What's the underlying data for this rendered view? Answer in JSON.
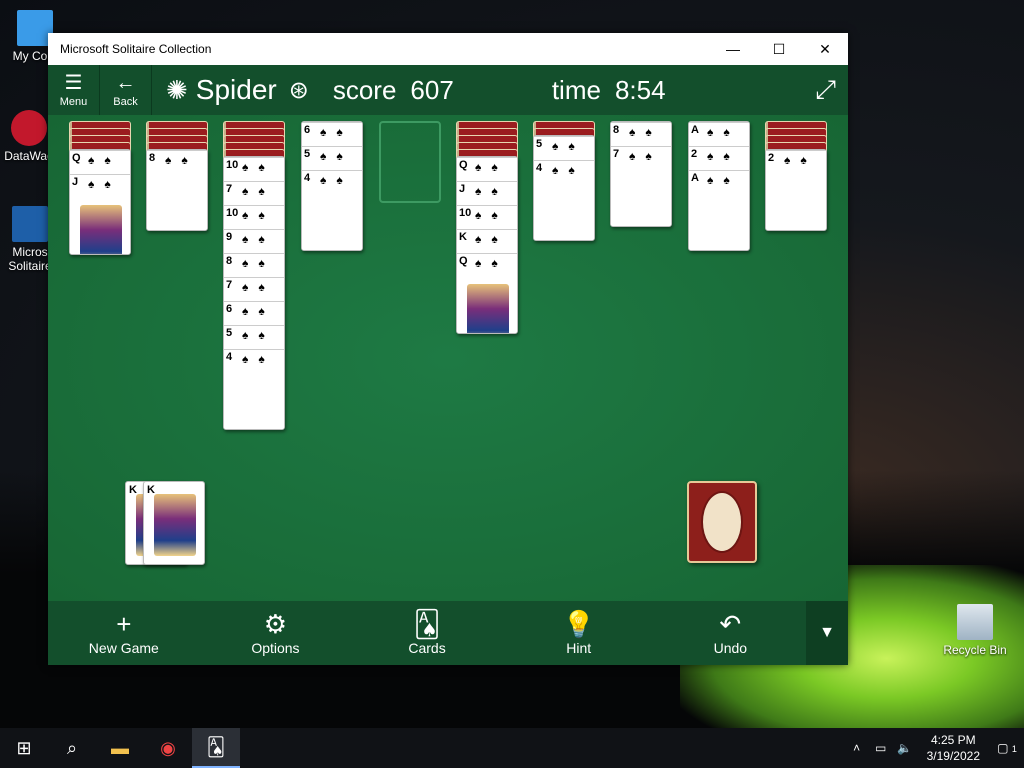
{
  "desktop": {
    "icons": [
      {
        "label": "My Com"
      },
      {
        "label": "DataWag"
      },
      {
        "label": "Micros Solitaire"
      },
      {
        "label": "Recycle Bin"
      }
    ]
  },
  "window": {
    "title": "Microsoft Solitaire Collection",
    "controls": {
      "minimize": "—",
      "maximize": "☐",
      "close": "✕"
    }
  },
  "appbar": {
    "menu_label": "Menu",
    "back_label": "Back",
    "game_title": "Spider",
    "score_label": "score",
    "score_value": "607",
    "time_label": "time",
    "time_value": "8:54"
  },
  "tableau": {
    "columns": [
      {
        "hidden": 4,
        "face": [
          "Q",
          "J"
        ]
      },
      {
        "hidden": 4,
        "face": [
          "8"
        ]
      },
      {
        "hidden": 5,
        "face": [
          "10",
          "7",
          "10",
          "9",
          "8",
          "7",
          "6",
          "5",
          "4"
        ]
      },
      {
        "hidden": 0,
        "face": [
          "6",
          "5",
          "4"
        ]
      },
      {
        "hidden": 0,
        "face": [],
        "empty": true
      },
      {
        "hidden": 5,
        "face": [
          "Q",
          "J",
          "10",
          "K",
          "Q"
        ]
      },
      {
        "hidden": 2,
        "face": [
          "5",
          "4"
        ]
      },
      {
        "hidden": 0,
        "face": [
          "8",
          "7"
        ]
      },
      {
        "hidden": 0,
        "face": [
          "A",
          "2",
          "A"
        ]
      },
      {
        "hidden": 4,
        "face": [
          "2"
        ]
      }
    ],
    "suit_glyph": "♠",
    "completed_piles": [
      "K",
      "K"
    ]
  },
  "bottombar": {
    "new_game_label": "New Game",
    "options_label": "Options",
    "cards_label": "Cards",
    "hint_label": "Hint",
    "undo_label": "Undo"
  },
  "taskbar": {
    "time": "4:25 PM",
    "date": "3/19/2022",
    "notification_count": "1"
  },
  "colors": {
    "felt": "#1b6a3c",
    "bar": "#134f2c",
    "card_back": "#9b1c1f"
  }
}
